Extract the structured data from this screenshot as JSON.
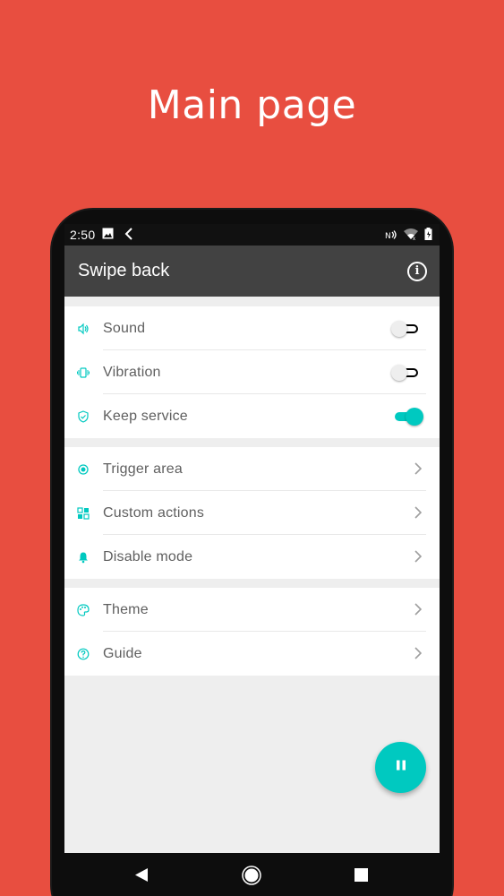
{
  "promo": {
    "title": "Main page"
  },
  "status_bar": {
    "time": "2:50"
  },
  "app_bar": {
    "title": "Swipe back",
    "info_icon": "info-icon"
  },
  "colors": {
    "background": "#E84E40",
    "accent": "#00C9C0",
    "app_bar": "#424242"
  },
  "settings_group_1": [
    {
      "label": "Sound",
      "icon": "volume-icon",
      "switch_on": false
    },
    {
      "label": "Vibration",
      "icon": "vibration-icon",
      "switch_on": false
    },
    {
      "label": "Keep service",
      "icon": "shield-icon",
      "switch_on": true
    }
  ],
  "settings_group_2": [
    {
      "label": "Trigger area",
      "icon": "target-icon"
    },
    {
      "label": "Custom actions",
      "icon": "grid-icon"
    },
    {
      "label": "Disable mode",
      "icon": "bell-icon"
    }
  ],
  "settings_group_3": [
    {
      "label": "Theme",
      "icon": "palette-icon"
    },
    {
      "label": "Guide",
      "icon": "help-icon"
    }
  ],
  "fab": {
    "icon": "pause-icon"
  },
  "nav_bar": {
    "back": "back-icon",
    "home": "home-icon",
    "recents": "recents-icon"
  }
}
